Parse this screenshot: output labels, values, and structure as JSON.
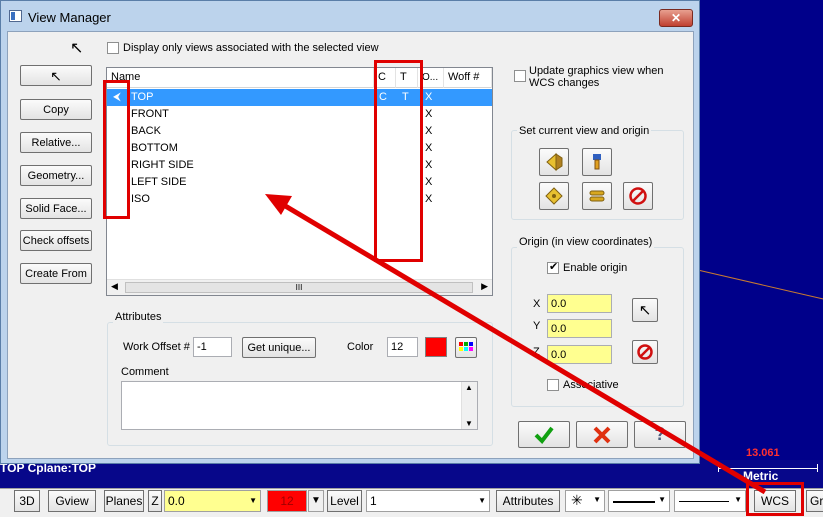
{
  "window": {
    "title": "View Manager",
    "close_glyph": "✕",
    "display_only_label": "Display only views associated with the selected view",
    "update_graphics_label": "Update graphics view when WCS changes",
    "buttons": [
      "",
      "Copy",
      "Relative...",
      "Geometry...",
      "Solid Face...",
      "Check offsets",
      "Create From"
    ]
  },
  "view_list": {
    "columns": [
      "Name",
      "C",
      "T",
      "O...",
      "Woff #"
    ],
    "rows": [
      {
        "name": "TOP",
        "c": "C",
        "t": "T",
        "o": "X",
        "woff": ""
      },
      {
        "name": "FRONT",
        "c": "",
        "t": "",
        "o": "X",
        "woff": ""
      },
      {
        "name": "BACK",
        "c": "",
        "t": "",
        "o": "X",
        "woff": ""
      },
      {
        "name": "BOTTOM",
        "c": "",
        "t": "",
        "o": "X",
        "woff": ""
      },
      {
        "name": "RIGHT SIDE",
        "c": "",
        "t": "",
        "o": "X",
        "woff": ""
      },
      {
        "name": "LEFT SIDE",
        "c": "",
        "t": "",
        "o": "X",
        "woff": ""
      },
      {
        "name": "ISO",
        "c": "",
        "t": "",
        "o": "X",
        "woff": ""
      }
    ],
    "scroll_thumb_glyph": "III"
  },
  "set_current": {
    "label": "Set current view and origin"
  },
  "origin": {
    "label": "Origin (in view coordinates)",
    "enable_label": "Enable origin",
    "x_label": "X",
    "x_value": "0.0",
    "y_label": "Y",
    "y_value": "0.0",
    "z_label": "Z",
    "z_value": "0.0",
    "associative_label": "Associative"
  },
  "attributes": {
    "label": "Attributes",
    "work_offset_label": "Work Offset #",
    "work_offset_value": "-1",
    "get_unique_label": "Get unique...",
    "color_label": "Color",
    "color_value": "12",
    "color_swatch": "#ff0000",
    "comment_label": "Comment"
  },
  "status_line": {
    "text": "TOP  Cplane:TOP",
    "scale_value": "13.061",
    "scale_unit": "Metric"
  },
  "toolbar": {
    "btn_3d": "3D",
    "gview": "Gview",
    "planes": "Planes",
    "z_label": "Z",
    "z_value": "0.0",
    "color_value": "12",
    "level_label": "Level",
    "level_value": "1",
    "attributes": "Attributes",
    "wcs": "WCS",
    "gr": "Gr"
  },
  "colors": {
    "title_bar": "#bcd3ec",
    "selection": "#3399ff",
    "annotation": "#e00000",
    "canvas": "#00008a"
  }
}
